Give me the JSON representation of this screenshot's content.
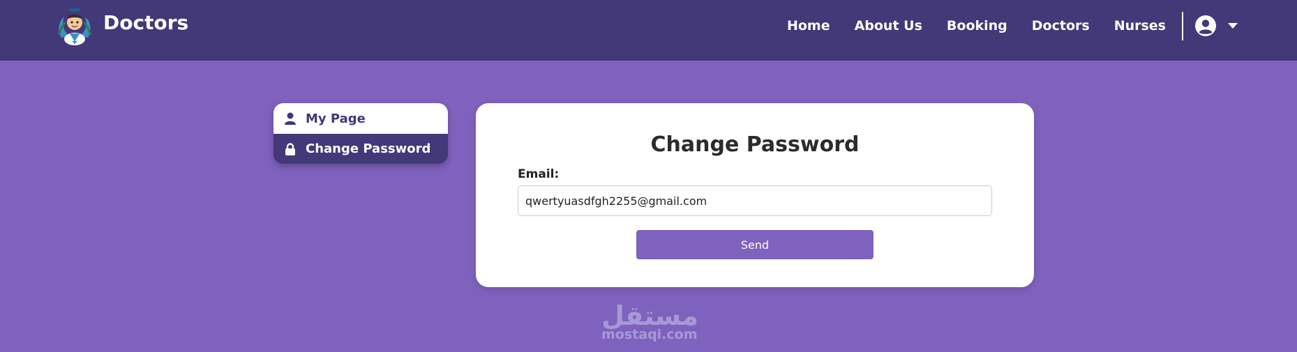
{
  "brand": {
    "name": "Doctors",
    "logo": "doctor-mascot-logo"
  },
  "nav": {
    "links": [
      "Home",
      "About Us",
      "Booking",
      "Doctors",
      "Nurses"
    ],
    "user_icon": "user-circle-icon",
    "dropdown_icon": "caret-down-icon"
  },
  "sidebar": {
    "items": [
      {
        "label": "My Page",
        "icon": "user-icon"
      },
      {
        "label": "Change Password",
        "icon": "lock-icon"
      }
    ]
  },
  "form": {
    "title": "Change Password",
    "email_label": "Email:",
    "email_value": "qwertyuasdfgh2255@gmail.com",
    "submit_label": "Send"
  },
  "watermark": {
    "arabic": "مستقل",
    "latin": "mostaqi.com"
  },
  "colors": {
    "nav_bg": "#433878",
    "page_bg": "#7f62be",
    "accent": "#7f62be",
    "card_bg": "#ffffff"
  }
}
